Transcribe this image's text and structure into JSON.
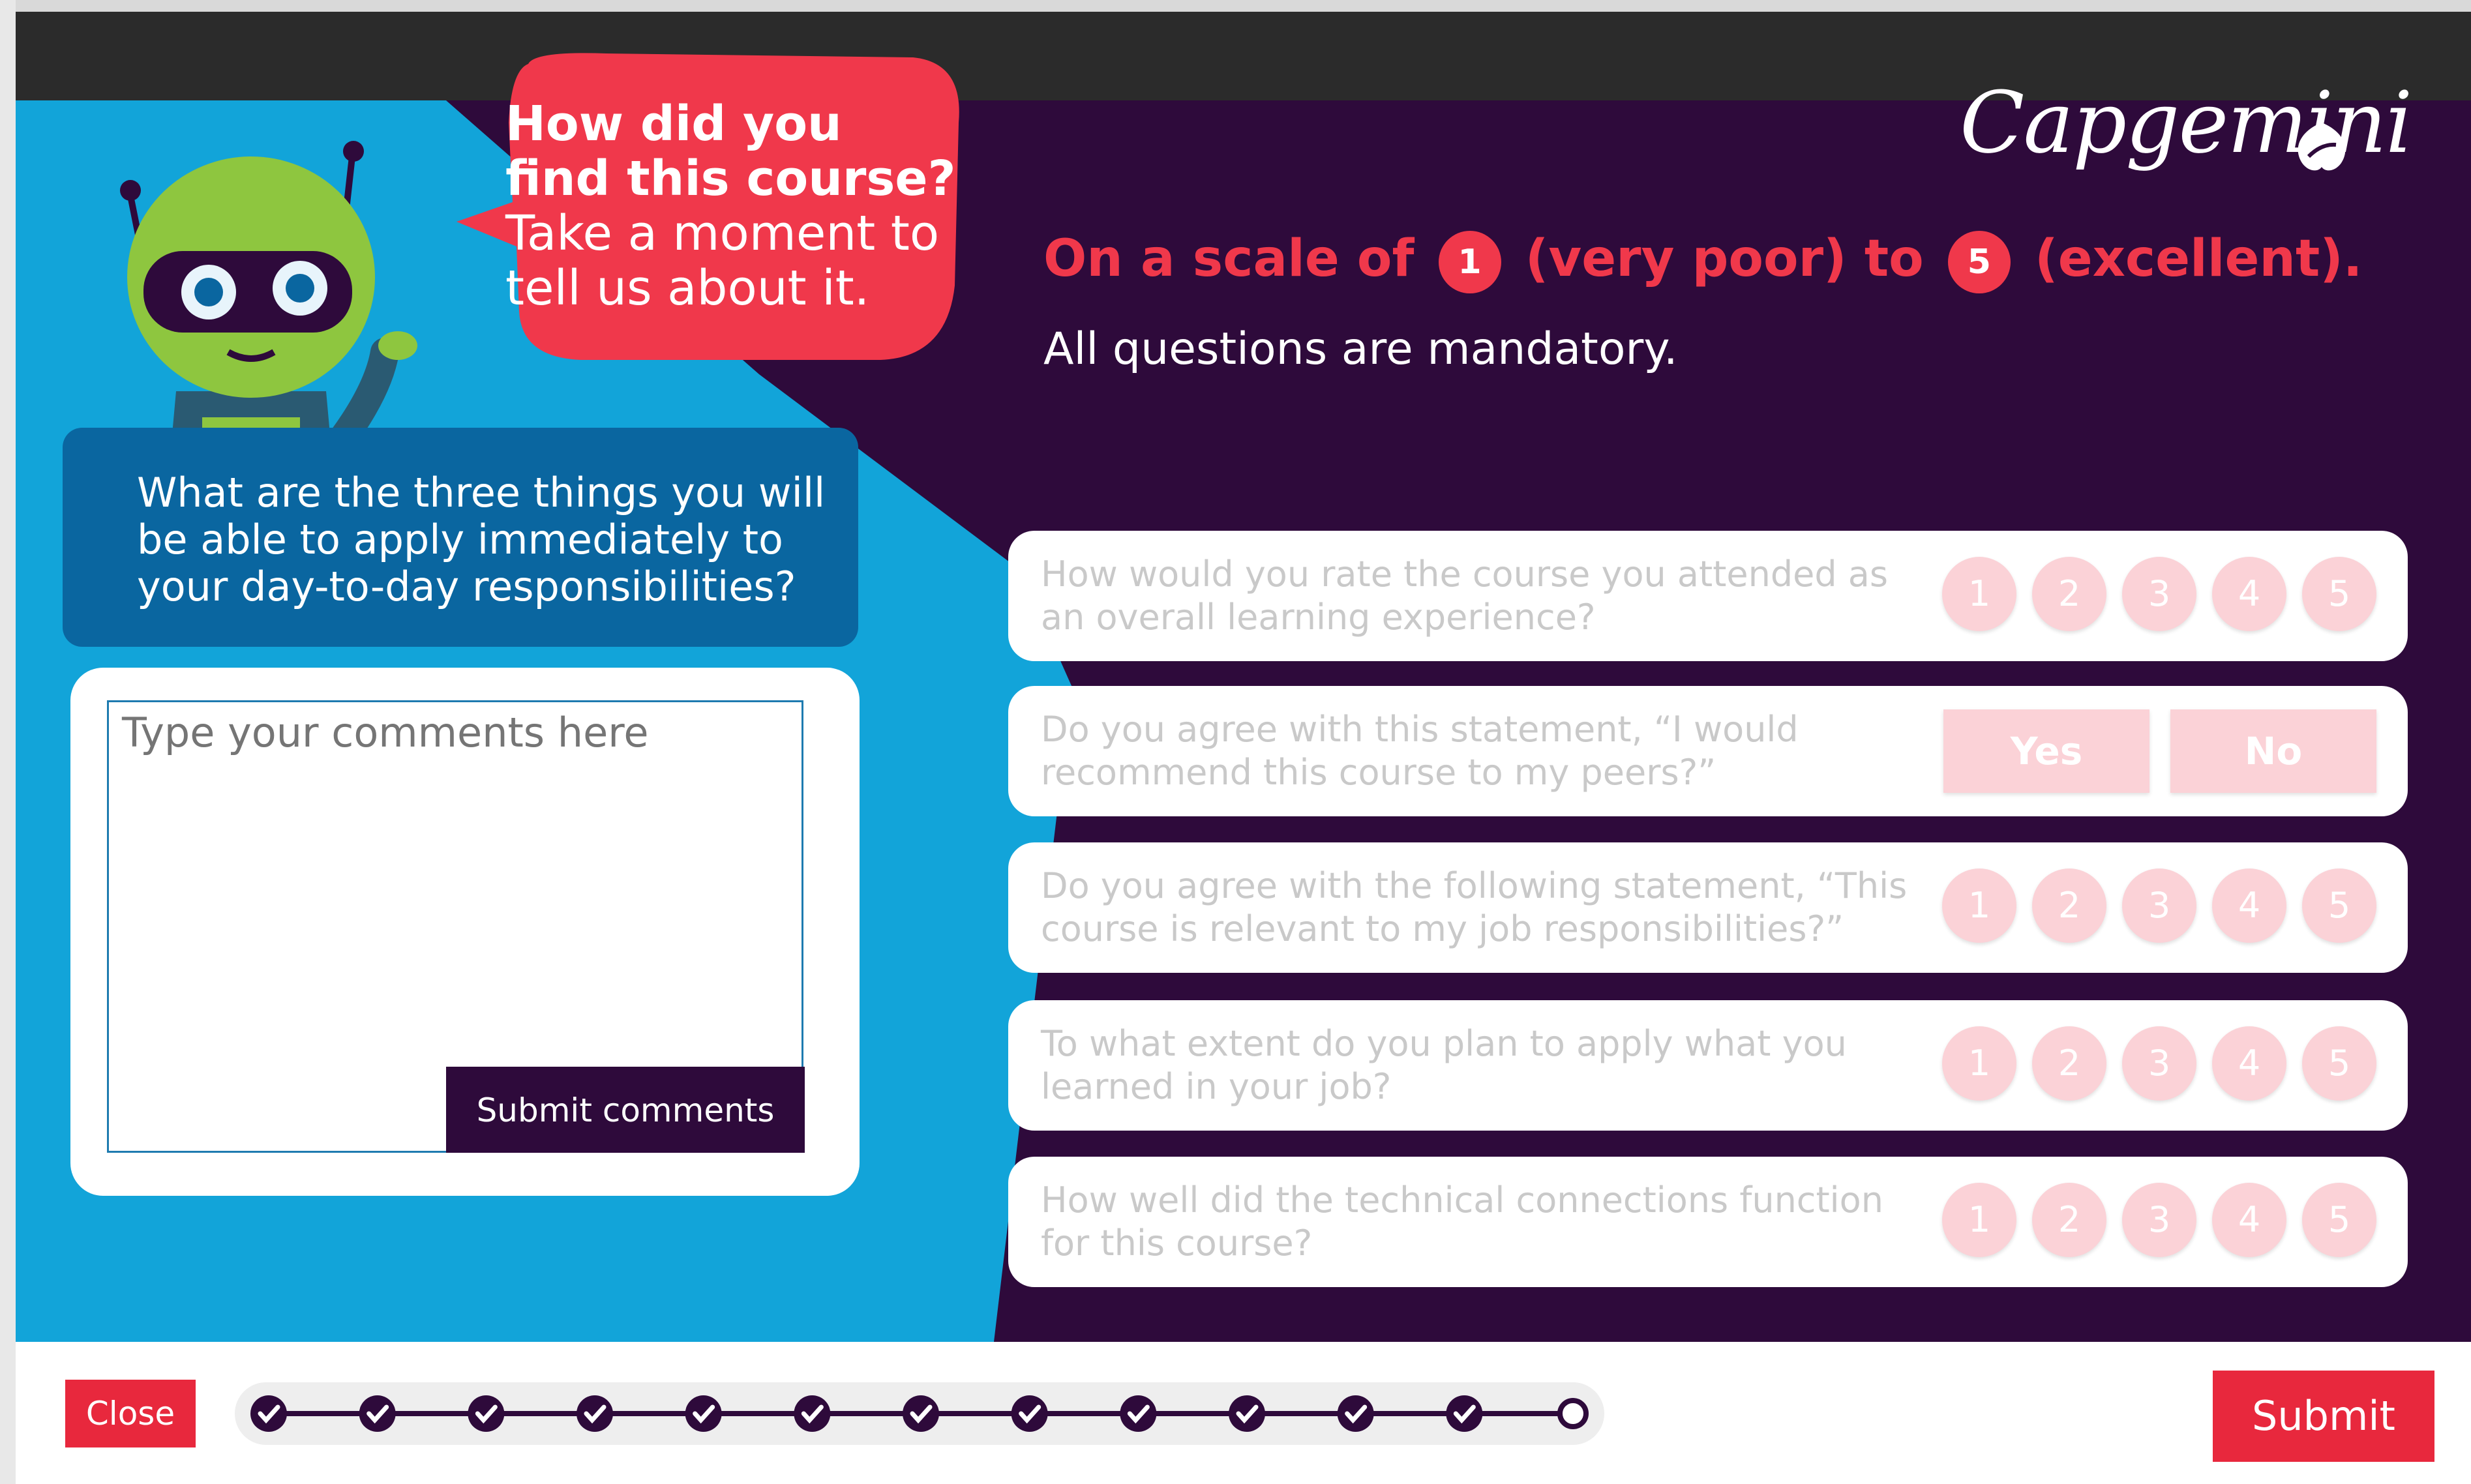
{
  "brand": {
    "logo_text": "Capgemini",
    "accent": "#f0384b",
    "dark": "#2e0a3b",
    "blue": "#0a66a0"
  },
  "bubble": {
    "title": "How did you find this course?",
    "subtitle": "Take a moment to tell us about it."
  },
  "open_question": {
    "text": "What are the three things you will be able to apply immediately to your day-to-day responsibilities?"
  },
  "comment": {
    "placeholder": "Type your comments here",
    "submit_label": "Submit comments"
  },
  "scale": {
    "prefix": "On a scale of",
    "low_num": "1",
    "low_label": "(very poor) to",
    "high_num": "5",
    "high_label": "(excellent)."
  },
  "mandatory": "All questions are mandatory.",
  "questions": [
    {
      "text": "How would you rate the course you attended as an overall learning experience?",
      "type": "rating",
      "options": [
        "1",
        "2",
        "3",
        "4",
        "5"
      ]
    },
    {
      "text": "Do you agree with this statement, “I would recommend this course to my peers?”",
      "type": "yesno",
      "options": [
        "Yes",
        "No"
      ]
    },
    {
      "text": "Do you agree with the following statement, “This course is relevant to my job responsibilities?”",
      "type": "rating",
      "options": [
        "1",
        "2",
        "3",
        "4",
        "5"
      ]
    },
    {
      "text": "To what extent do you plan to apply what you learned in your job?",
      "type": "rating",
      "options": [
        "1",
        "2",
        "3",
        "4",
        "5"
      ]
    },
    {
      "text": "How well did the technical connections function for this course?",
      "type": "rating",
      "options": [
        "1",
        "2",
        "3",
        "4",
        "5"
      ]
    }
  ],
  "footer": {
    "close_label": "Close",
    "submit_label": "Submit"
  },
  "progress": {
    "completed_steps": 12,
    "total_steps": 13
  }
}
